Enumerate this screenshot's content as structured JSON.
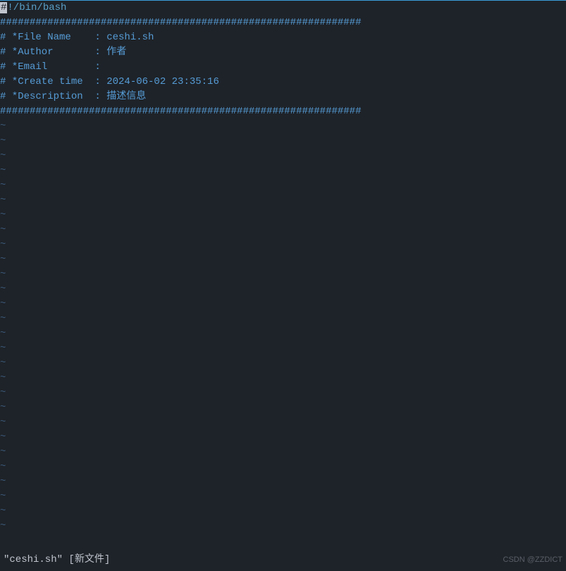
{
  "editor": {
    "shebang_cursor": "#",
    "shebang_rest": "!/bin/bash",
    "separator": "#############################################################",
    "file_name_line": "# *File Name    : ceshi.sh",
    "author_prefix": "# *Author       : ",
    "author_value": "作者",
    "email_line": "# *Email        :",
    "create_time_line": "# *Create time  : 2024-06-02 23:35:16",
    "description_prefix": "# *Description  : ",
    "description_value": "描述信息",
    "tilde": "~",
    "tilde_count": 28
  },
  "status": {
    "file_info": "\"ceshi.sh\" [新文件]",
    "watermark": "CSDN @ZZDICT"
  }
}
